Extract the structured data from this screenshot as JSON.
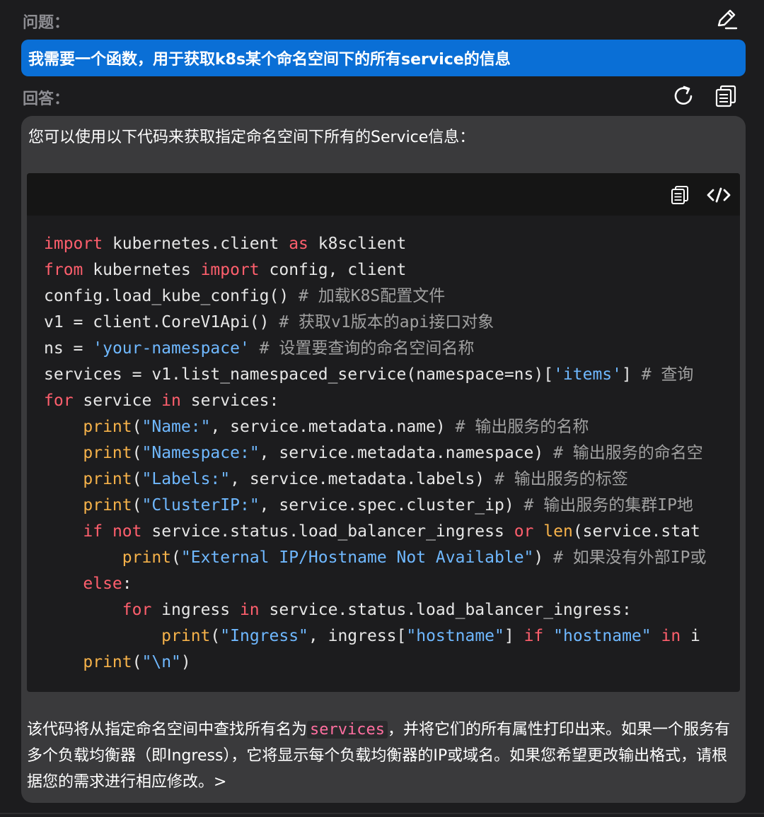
{
  "question": {
    "label": "问题：",
    "text": "我需要一个函数，用于获取k8s某个命名空间下的所有service的信息"
  },
  "answer": {
    "label": "回答：",
    "intro": "您可以使用以下代码来获取指定命名空间下所有的Service信息：",
    "code": {
      "lines": [
        [
          [
            "kw",
            "import"
          ],
          [
            "t",
            " kubernetes.client "
          ],
          [
            "kw",
            "as"
          ],
          [
            "t",
            " k8sclient"
          ]
        ],
        [
          [
            "kw",
            "from"
          ],
          [
            "t",
            " kubernetes "
          ],
          [
            "kw",
            "import"
          ],
          [
            "t",
            " config, client"
          ]
        ],
        [
          [
            "t",
            "config.load_kube_config() "
          ],
          [
            "cm",
            "# 加载K8S配置文件"
          ]
        ],
        [
          [
            "t",
            "v1 = client.CoreV1Api() "
          ],
          [
            "cm",
            "# 获取v1版本的api接口对象"
          ]
        ],
        [
          [
            "t",
            "ns = "
          ],
          [
            "str",
            "'your-namespace'"
          ],
          [
            "t",
            " "
          ],
          [
            "cm",
            "# 设置要查询的命名空间名称"
          ]
        ],
        [
          [
            "t",
            "services = v1.list_namespaced_service(namespace=ns)["
          ],
          [
            "str",
            "'items'"
          ],
          [
            "t",
            "] "
          ],
          [
            "cm",
            "# 查询"
          ]
        ],
        [
          [
            "kw",
            "for"
          ],
          [
            "t",
            " service "
          ],
          [
            "kw",
            "in"
          ],
          [
            "t",
            " services:"
          ]
        ],
        [
          [
            "t",
            "    "
          ],
          [
            "fn",
            "print"
          ],
          [
            "t",
            "("
          ],
          [
            "str",
            "\"Name:\""
          ],
          [
            "t",
            ", service.metadata.name) "
          ],
          [
            "cm",
            "# 输出服务的名称"
          ]
        ],
        [
          [
            "t",
            "    "
          ],
          [
            "fn",
            "print"
          ],
          [
            "t",
            "("
          ],
          [
            "str",
            "\"Namespace:\""
          ],
          [
            "t",
            ", service.metadata.namespace) "
          ],
          [
            "cm",
            "# 输出服务的命名空"
          ]
        ],
        [
          [
            "t",
            "    "
          ],
          [
            "fn",
            "print"
          ],
          [
            "t",
            "("
          ],
          [
            "str",
            "\"Labels:\""
          ],
          [
            "t",
            ", service.metadata.labels) "
          ],
          [
            "cm",
            "# 输出服务的标签"
          ]
        ],
        [
          [
            "t",
            "    "
          ],
          [
            "fn",
            "print"
          ],
          [
            "t",
            "("
          ],
          [
            "str",
            "\"ClusterIP:\""
          ],
          [
            "t",
            ", service.spec.cluster_ip) "
          ],
          [
            "cm",
            "# 输出服务的集群IP地"
          ]
        ],
        [
          [
            "t",
            "    "
          ],
          [
            "kw",
            "if"
          ],
          [
            "t",
            " "
          ],
          [
            "kw",
            "not"
          ],
          [
            "t",
            " service.status.load_balancer_ingress "
          ],
          [
            "kw",
            "or"
          ],
          [
            "t",
            " "
          ],
          [
            "fn",
            "len"
          ],
          [
            "t",
            "(service.stat"
          ]
        ],
        [
          [
            "t",
            "        "
          ],
          [
            "fn",
            "print"
          ],
          [
            "t",
            "("
          ],
          [
            "str",
            "\"External IP/Hostname Not Available\""
          ],
          [
            "t",
            ") "
          ],
          [
            "cm",
            "# 如果没有外部IP或"
          ]
        ],
        [
          [
            "t",
            "    "
          ],
          [
            "kw",
            "else"
          ],
          [
            "t",
            ":"
          ]
        ],
        [
          [
            "t",
            "        "
          ],
          [
            "kw",
            "for"
          ],
          [
            "t",
            " ingress "
          ],
          [
            "kw",
            "in"
          ],
          [
            "t",
            " service.status.load_balancer_ingress:"
          ]
        ],
        [
          [
            "t",
            "            "
          ],
          [
            "fn",
            "print"
          ],
          [
            "t",
            "("
          ],
          [
            "str",
            "\"Ingress\""
          ],
          [
            "t",
            ", ingress["
          ],
          [
            "str",
            "\"hostname\""
          ],
          [
            "t",
            "] "
          ],
          [
            "kw",
            "if"
          ],
          [
            "t",
            " "
          ],
          [
            "str",
            "\"hostname\""
          ],
          [
            "t",
            " "
          ],
          [
            "kw",
            "in"
          ],
          [
            "t",
            " i"
          ]
        ],
        [
          [
            "t",
            "    "
          ],
          [
            "fn",
            "print"
          ],
          [
            "t",
            "("
          ],
          [
            "str",
            "\"\\n\""
          ],
          [
            "t",
            ")"
          ]
        ]
      ]
    },
    "summary_before": "该代码将从指定命名空间中查找所有名为",
    "summary_code": "services",
    "summary_after": "，并将它们的所有属性打印出来。如果一个服务有多个负载均衡器（即Ingress），它将显示每个负载均衡器的IP或域名。如果您希望更改输出格式，请根据您的需求进行相应修改。>"
  },
  "icons": {
    "edit": "edit-icon",
    "refresh": "refresh-icon",
    "copy": "copy-icon",
    "code_view": "code-view-icon"
  },
  "colors": {
    "question_bubble": "#0a6fd6",
    "answer_bubble": "#3a3a3c",
    "keyword": "#ff5f6d",
    "function": "#f6b24a",
    "string": "#6fb8ff",
    "comment": "#a0a0a0"
  }
}
